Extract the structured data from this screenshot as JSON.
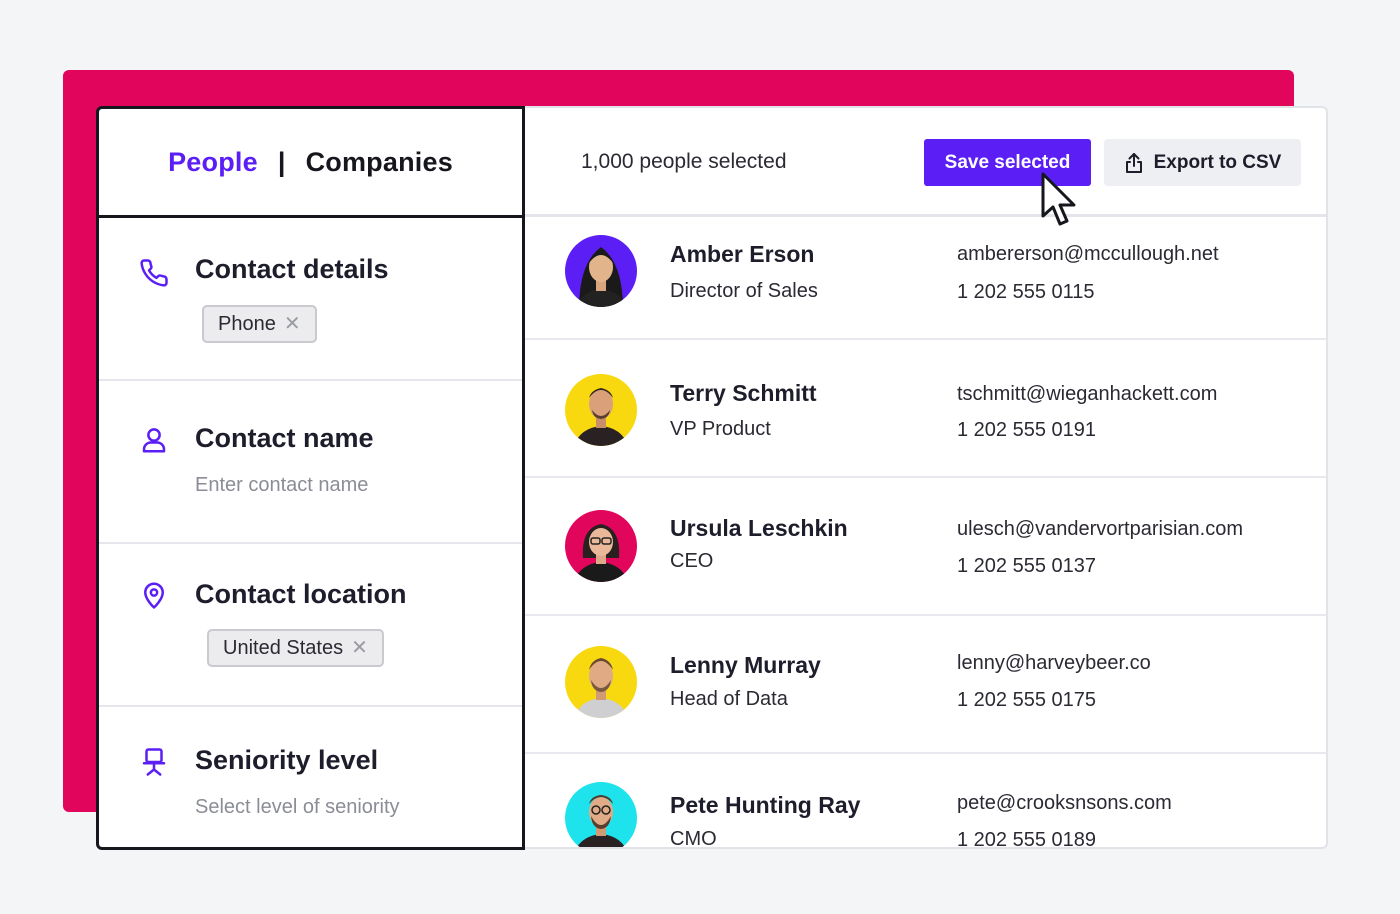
{
  "tabs": {
    "people": "People",
    "separator": "|",
    "companies": "Companies"
  },
  "filters": [
    {
      "title": "Contact details",
      "icon": "phone-icon",
      "chip": "Phone"
    },
    {
      "title": "Contact name",
      "icon": "user-icon",
      "placeholder": "Enter contact name"
    },
    {
      "title": "Contact location",
      "icon": "map-pin-icon",
      "chip": "United States"
    },
    {
      "title": "Seniority level",
      "icon": "chair-icon",
      "placeholder": "Select level of seniority"
    }
  ],
  "toolbar": {
    "selected_count": "1,000 people selected",
    "save_label": "Save selected",
    "export_label": "Export to CSV"
  },
  "people": [
    {
      "name": "Amber Erson",
      "title": "Director of Sales",
      "email": "ambererson@mccullough.net",
      "phone": "1 202 555 0115",
      "avatar_bg": "#5b1ff5"
    },
    {
      "name": "Terry Schmitt",
      "title": "VP Product",
      "email": "tschmitt@wieganhackett.com",
      "phone": "1 202 555 0191",
      "avatar_bg": "#f8d90f"
    },
    {
      "name": "Ursula Leschkin",
      "title": "CEO",
      "email": "ulesch@vandervortparisian.com",
      "phone": "1 202 555 0137",
      "avatar_bg": "#e2055c"
    },
    {
      "name": "Lenny Murray",
      "title": "Head of Data",
      "email": "lenny@harveybeer.co",
      "phone": "1 202 555 0175",
      "avatar_bg": "#f8d90f"
    },
    {
      "name": "Pete Hunting Ray",
      "title": "CMO",
      "email": "pete@crooksnsons.com",
      "phone": "1 202 555 0189",
      "avatar_bg": "#1ee3ec"
    }
  ],
  "colors": {
    "accent": "#5b1ff5",
    "backdrop": "#e2055c"
  }
}
